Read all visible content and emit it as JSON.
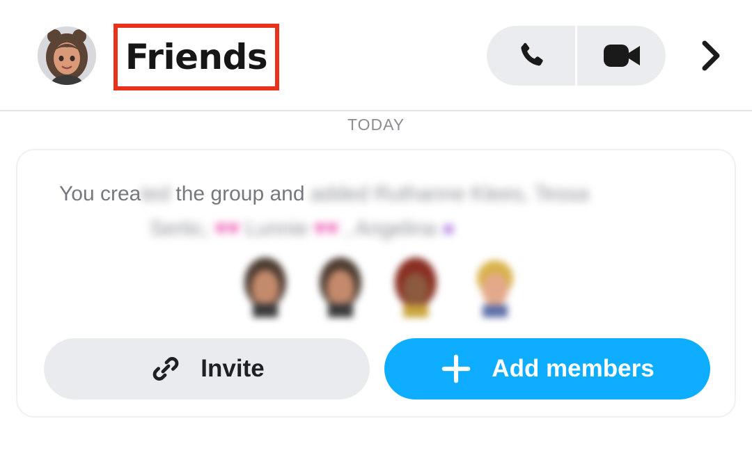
{
  "header": {
    "title": "Friends",
    "highlight_color": "#e8321c",
    "icons": {
      "avatar": "bitmoji-avatar",
      "call": "phone-icon",
      "video": "video-camera-icon",
      "more": "chevron-right-icon"
    }
  },
  "chat": {
    "date_separator": "TODAY",
    "group_notice": {
      "visible_text_start": "You crea",
      "visible_text_mid": "the group and",
      "blurred_segments": [
        "ted",
        "added Ruthanne Klees, Tessa",
        "Sertic,",
        "Lunnie",
        ", Angelina"
      ]
    },
    "actions": {
      "invite_label": "Invite",
      "add_members_label": "Add members"
    },
    "colors": {
      "accent_blue": "#0fadff",
      "pill_grey": "#e9ebee"
    }
  }
}
